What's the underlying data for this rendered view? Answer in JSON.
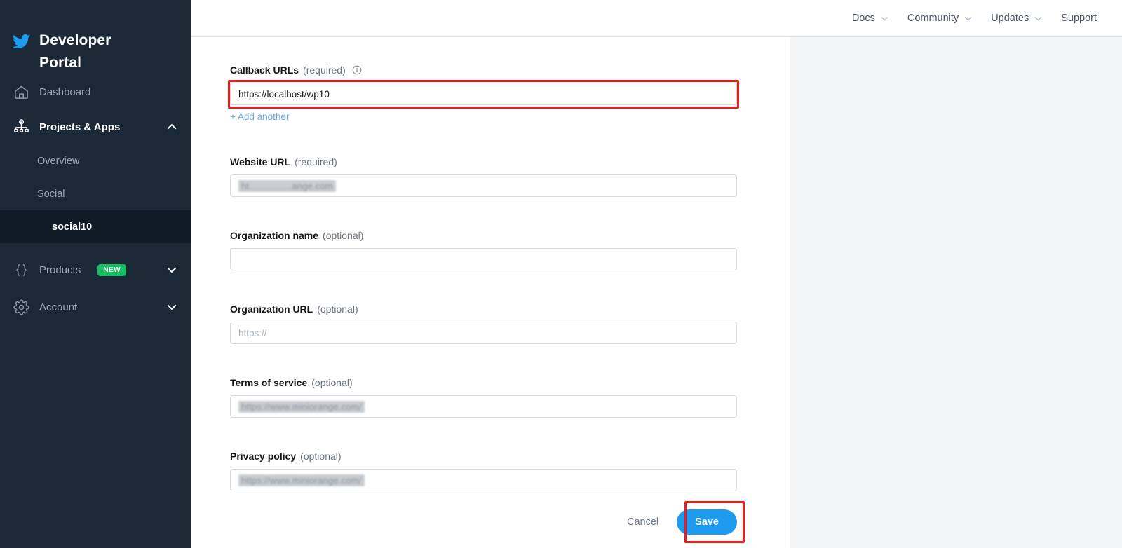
{
  "sidebar": {
    "brand": {
      "title": "Developer Portal",
      "icon": "twitter-bird-icon"
    },
    "items": [
      {
        "label": "Dashboard",
        "icon": "home-icon",
        "active": false,
        "expandable": false
      },
      {
        "label": "Projects & Apps",
        "icon": "projects-icon",
        "active": true,
        "expandable": true,
        "chevron": "chevron-up-icon"
      },
      {
        "label": "Products",
        "icon": "curly-braces-icon",
        "active": false,
        "expandable": true,
        "chevron": "chevron-down-icon",
        "badge": "NEW"
      },
      {
        "label": "Account",
        "icon": "gear-icon",
        "active": false,
        "expandable": true,
        "chevron": "chevron-down-icon"
      }
    ],
    "sub_items": [
      {
        "label": "Overview",
        "current": false
      },
      {
        "label": "Social",
        "current": false
      },
      {
        "label": "social10",
        "current": true
      }
    ]
  },
  "topbar": {
    "items": [
      {
        "label": "Docs",
        "caret": true
      },
      {
        "label": "Community",
        "caret": true
      },
      {
        "label": "Updates",
        "caret": true
      },
      {
        "label": "Support",
        "caret": false
      }
    ]
  },
  "form": {
    "callback_urls": {
      "label": "Callback URLs",
      "optionality": "(required)",
      "info_icon": "info-circle-icon",
      "value": "https://localhost/wp10",
      "add_another": "+ Add another",
      "highlighted": true
    },
    "website_url": {
      "label": "Website URL",
      "optionality": "(required)",
      "value": "ht................ange.com",
      "redacted": true
    },
    "organization_name": {
      "label": "Organization name",
      "optionality": "(optional)",
      "value": ""
    },
    "organization_url": {
      "label": "Organization URL",
      "optionality": "(optional)",
      "value": "",
      "placeholder": "https://"
    },
    "terms_of_service": {
      "label": "Terms of service",
      "optionality": "(optional)",
      "value": "https://www.miniorange.com/",
      "redacted": true
    },
    "privacy_policy": {
      "label": "Privacy policy",
      "optionality": "(optional)",
      "value": "https://www.miniorange.com/",
      "redacted": true
    },
    "actions": {
      "cancel_label": "Cancel",
      "save_label": "Save",
      "save_highlighted": true
    }
  },
  "colors": {
    "sidebar_bg": "#1b2836",
    "sidebar_active_bg": "#101b26",
    "twitter_blue": "#1d9bf0",
    "badge_green": "#17bf63",
    "highlight_red": "#ef1b1b",
    "right_panel_bg": "#f4f5f7"
  }
}
